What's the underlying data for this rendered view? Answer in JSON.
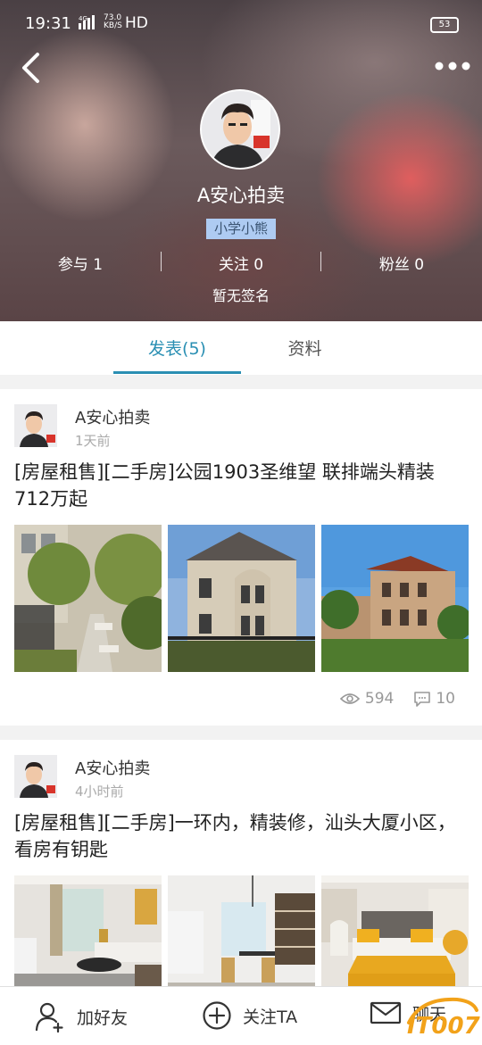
{
  "status_bar": {
    "time": "19:31",
    "signal": "4G",
    "speed_value": "73.0",
    "speed_unit": "KB/S",
    "hd": "HD",
    "battery": "53"
  },
  "header": {
    "profile_name": "A安心拍卖",
    "username": "小学小熊",
    "stats": {
      "participate": "参与 1",
      "following": "关注 0",
      "fans": "粉丝 0"
    },
    "signature": "暂无签名"
  },
  "tabs": [
    {
      "label": "发表(5)",
      "active": true
    },
    {
      "label": "资料",
      "active": false
    }
  ],
  "posts": [
    {
      "author": "A安心拍卖",
      "time": "1天前",
      "title": "[房屋租售][二手房]公园1903圣维望 联排端头精装 712万起",
      "views": "594",
      "comments": "10"
    },
    {
      "author": "A安心拍卖",
      "time": "4小时前",
      "title": "[房屋租售][二手房]一环内，精装修，汕头大厦小区，看房有钥匙"
    }
  ],
  "bottom_bar": {
    "add_friend": "加好友",
    "follow": "关注TA",
    "chat": "聊天"
  },
  "watermark": "IT007",
  "colors": {
    "accent": "#2a8fb3",
    "tag_bg": "#aecbf2"
  }
}
